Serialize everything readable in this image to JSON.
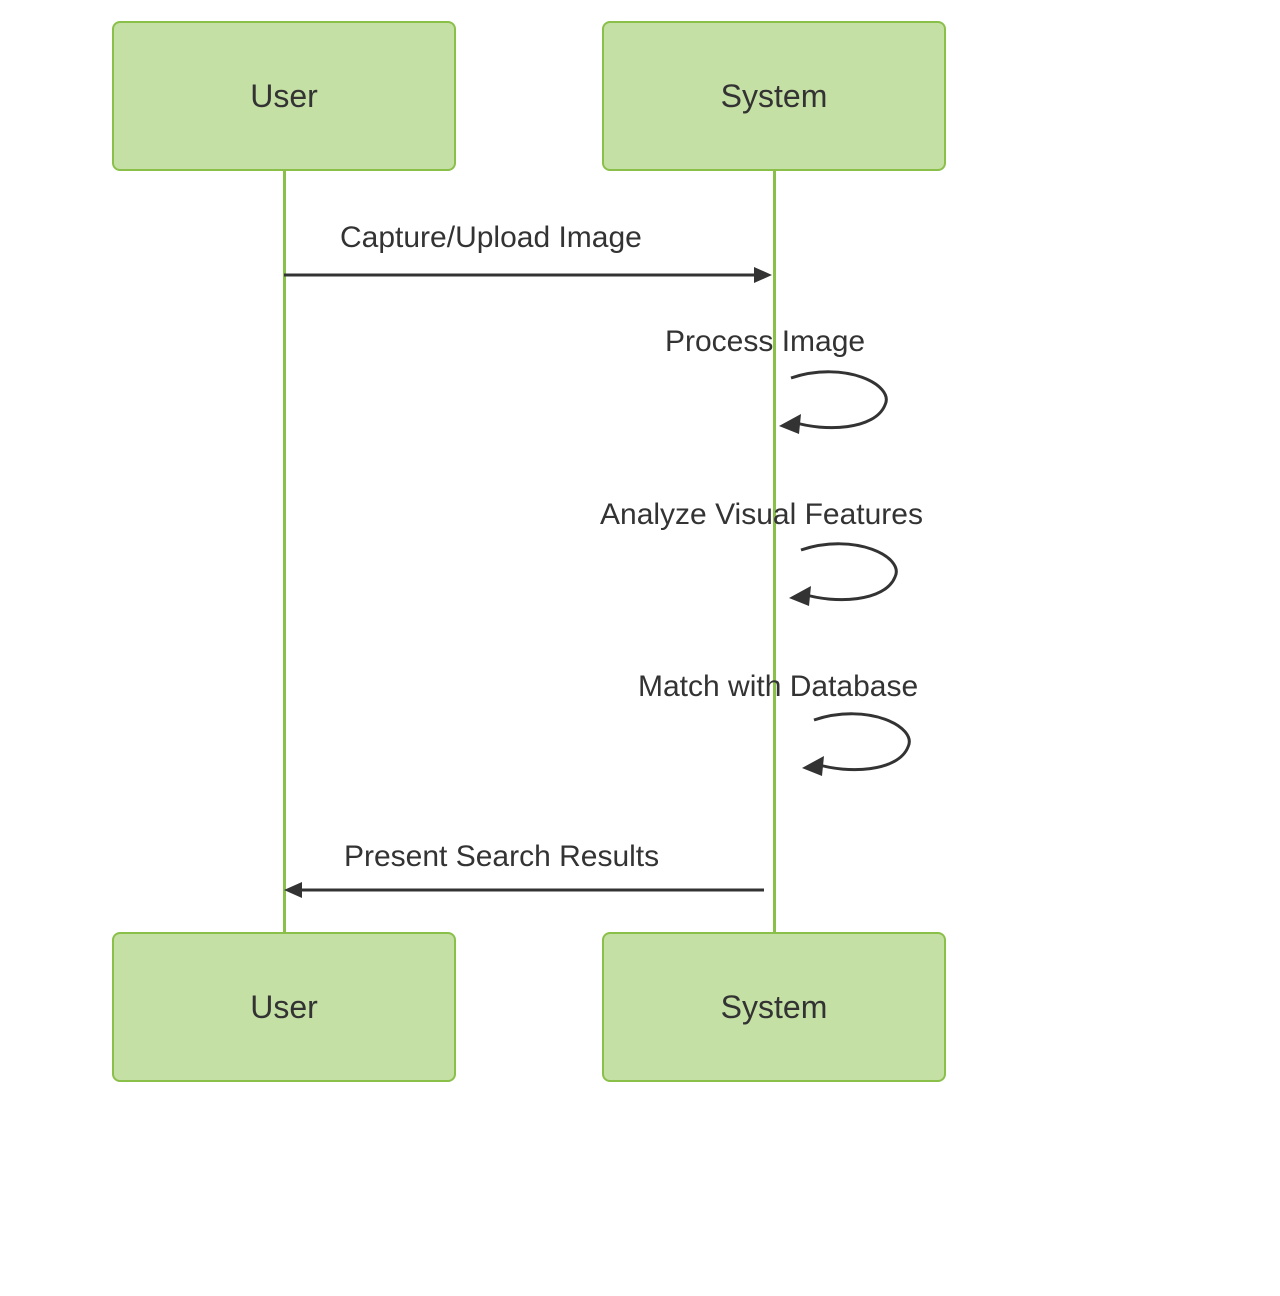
{
  "actors": {
    "user_top": "User",
    "system_top": "System",
    "user_bottom": "User",
    "system_bottom": "System"
  },
  "messages": {
    "capture_upload": "Capture/Upload Image",
    "process_image": "Process Image",
    "analyze_features": "Analyze Visual Features",
    "match_database": "Match with Database",
    "present_results": "Present Search Results"
  }
}
